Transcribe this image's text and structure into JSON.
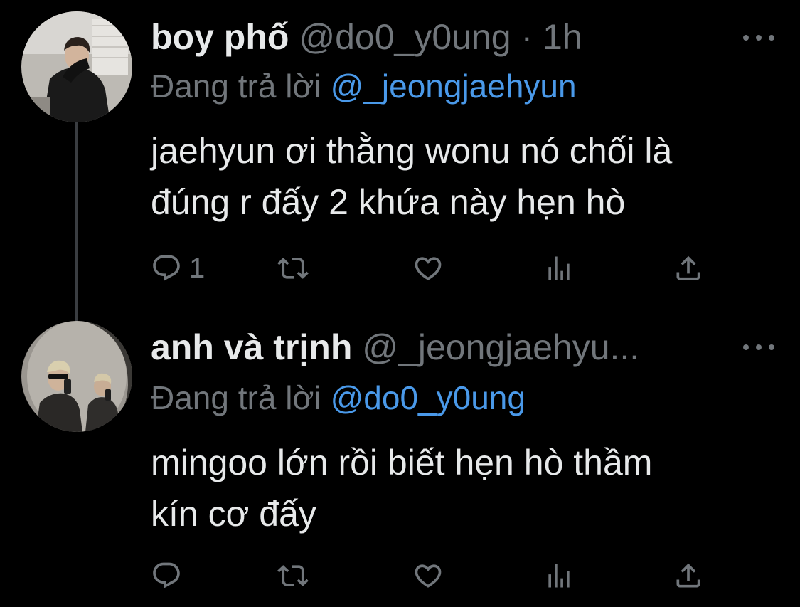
{
  "tweets": [
    {
      "display_name": "boy phố",
      "handle": "@do0_y0ung",
      "separator": "·",
      "time": "1h",
      "reply_prefix": "Đang trả lời",
      "reply_mention": "@_jeongjaehyun",
      "text_line1": "jaehyun ơi thằng wonu nó chối là",
      "text_line2": "đúng r đấy 2 khứa này hẹn hò",
      "reply_count": "1",
      "icons": [
        "more-icon",
        "reply-icon",
        "retweet-icon",
        "like-icon",
        "views-icon",
        "share-icon"
      ]
    },
    {
      "display_name": "anh và trịnh",
      "handle": "@_jeongjaehyu...",
      "reply_prefix": "Đang trả lời",
      "reply_mention": "@do0_y0ung",
      "text_line1": "mingoo lớn rồi biết hẹn hò thầm",
      "text_line2": "kín cơ đấy",
      "reply_count": "",
      "icons": [
        "more-icon",
        "reply-icon",
        "retweet-icon",
        "like-icon",
        "views-icon",
        "share-icon"
      ]
    }
  ],
  "colors": {
    "background": "#000000",
    "primary_text": "#e7e9ea",
    "secondary_text": "#71767b",
    "mention": "#4a99e9",
    "thread_line": "#3a3d41"
  }
}
